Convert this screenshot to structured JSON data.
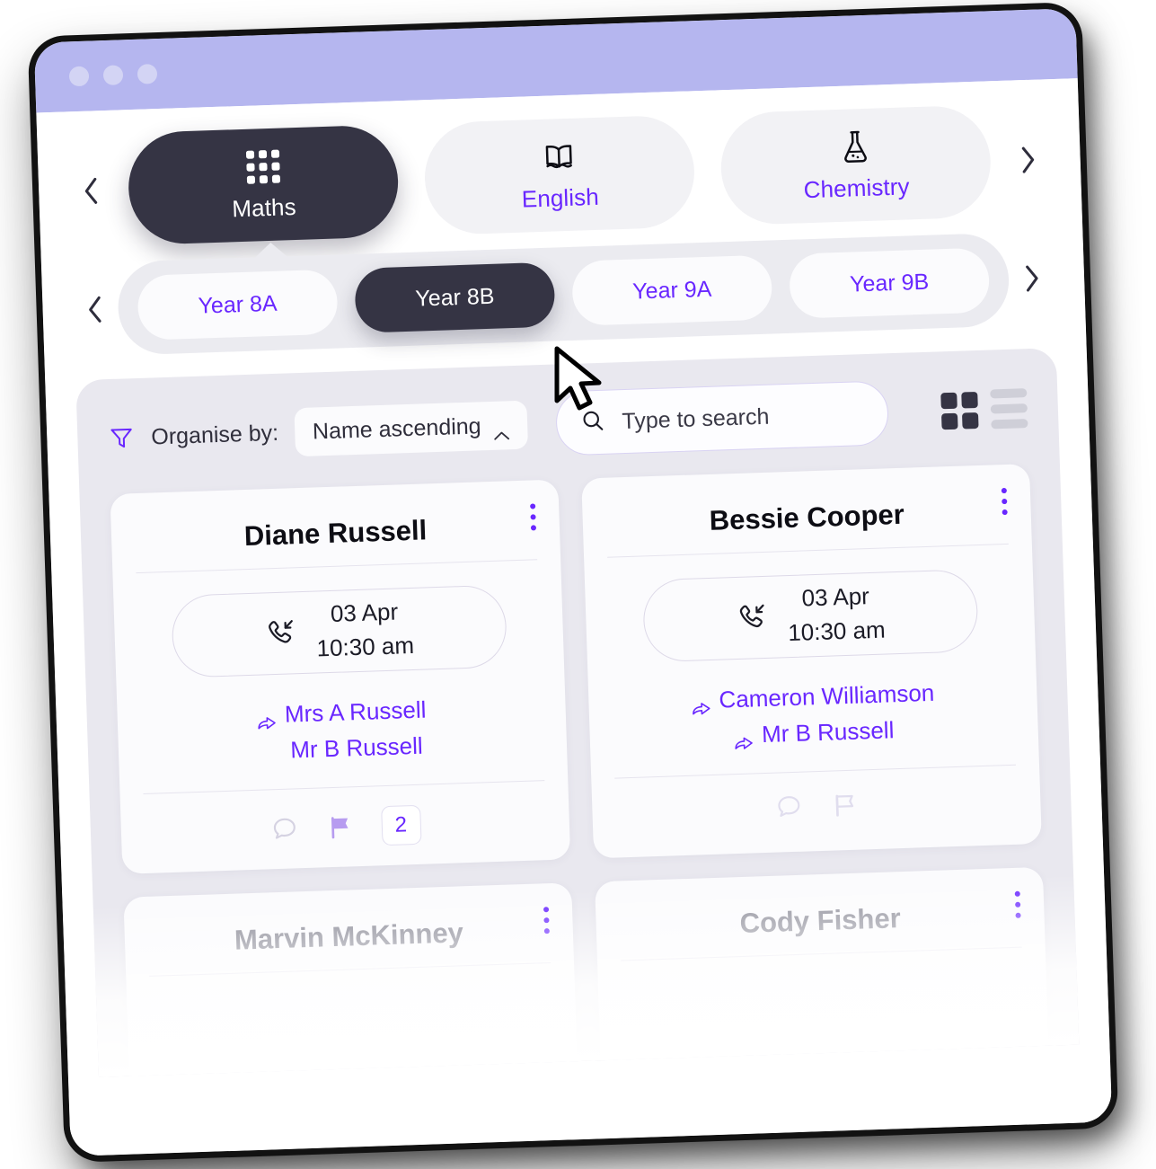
{
  "window": {
    "titlebar_dots": [
      "dot-1",
      "dot-2",
      "dot-3"
    ]
  },
  "subject_nav": {
    "prev_label": "‹",
    "next_label": "›",
    "items": [
      {
        "label": "Maths",
        "icon": "grid-icon",
        "active": true
      },
      {
        "label": "English",
        "icon": "book-icon",
        "active": false
      },
      {
        "label": "Chemistry",
        "icon": "flask-icon",
        "active": false
      }
    ]
  },
  "year_nav": {
    "prev_label": "‹",
    "next_label": "›",
    "items": [
      {
        "label": "Year 8A",
        "active": false
      },
      {
        "label": "Year 8B",
        "active": true
      },
      {
        "label": "Year 9A",
        "active": false
      },
      {
        "label": "Year 9B",
        "active": false
      }
    ]
  },
  "toolbar": {
    "filter_icon": "funnel-icon",
    "organise_label": "Organise by:",
    "sort_value": "Name ascending",
    "sort_chevron": "chevron-up-icon",
    "search_icon": "search-icon",
    "search_placeholder": "Type to search",
    "search_value": "",
    "view_grid": "grid-view-icon",
    "view_list": "list-view-icon",
    "active_view": "grid"
  },
  "students": [
    {
      "name": "Diane Russell",
      "call": {
        "icon": "incoming-call-icon",
        "date": "03 Apr",
        "time": "10:30 am"
      },
      "guardians": [
        {
          "name": "Mrs A Russell",
          "has_share_icon": true
        },
        {
          "name": "Mr B Russell",
          "has_share_icon": false
        }
      ],
      "actions": {
        "comment_icon": "comment-icon",
        "comment_active": false,
        "flag_icon": "flag-icon",
        "flag_active": true,
        "badge_count": "2"
      }
    },
    {
      "name": "Bessie Cooper",
      "call": {
        "icon": "incoming-call-icon",
        "date": "03 Apr",
        "time": "10:30 am"
      },
      "guardians": [
        {
          "name": "Cameron Williamson",
          "has_share_icon": true
        },
        {
          "name": "Mr B Russell",
          "has_share_icon": true
        }
      ],
      "actions": {
        "comment_icon": "comment-icon",
        "comment_active": false,
        "flag_icon": "flag-icon",
        "flag_active": false,
        "badge_count": ""
      }
    }
  ],
  "students_partial": [
    {
      "name": "Marvin McKinney"
    },
    {
      "name": "Cody Fisher"
    }
  ],
  "colors": {
    "accent_purple": "#6927ff",
    "flag_purple": "#b79cf0",
    "dark": "#353444",
    "titlebar": "#b5b6ef",
    "panel_bg": "#e9e8ef",
    "card_bg": "#fbfbfd"
  }
}
